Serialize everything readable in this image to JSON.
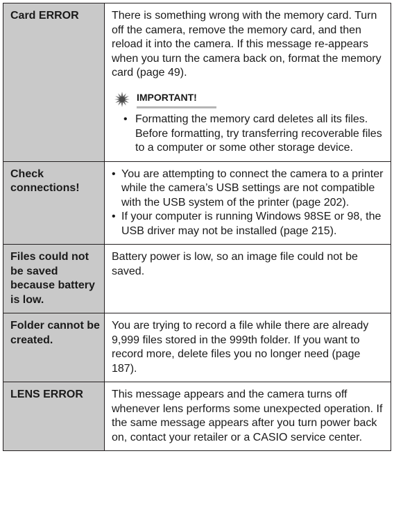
{
  "rows": [
    {
      "message": "Card ERROR",
      "description": "There is something wrong with the memory card. Turn off the camera, remove the memory card, and then reload it into the camera. If this message re-appears when you turn the camera back on, format the memory card (page 49).",
      "important": {
        "label": "IMPORTANT!",
        "items": [
          "Formatting the memory card deletes all its files. Before formatting, try transferring recoverable files to a computer or some other storage device."
        ]
      }
    },
    {
      "message": "Check connections!",
      "bullets": [
        "You are attempting to connect the camera to a printer while the camera’s USB settings are not compatible with the USB system of the printer (page 202).",
        "If your computer is running Windows 98SE or 98, the USB driver may not be installed (page 215)."
      ]
    },
    {
      "message": "Files could not be saved because battery is low.",
      "description": "Battery power is low, so an image file could not be saved."
    },
    {
      "message": "Folder cannot be created.",
      "description": "You are trying to record a file while there are already 9,999 files stored in the 999th folder. If you want to record more, delete files you no longer need (page 187)."
    },
    {
      "message": "LENS ERROR",
      "description": "This message appears and the camera turns off whenever lens performs some unexpected operation. If the same message appears after you turn power back on, contact your retailer or a CASIO service center."
    }
  ],
  "colors": {
    "message_column_bg": "#c9c9c9",
    "border": "#231f20",
    "important_icon": "#6b6b6b",
    "important_underline": "#b5b5b5"
  },
  "icons": {
    "important": "starburst-icon"
  }
}
